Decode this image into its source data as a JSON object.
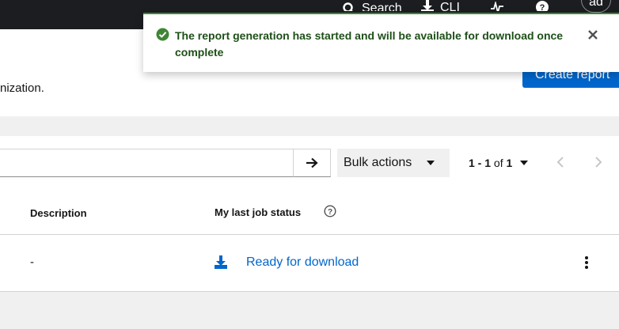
{
  "masthead": {
    "search_label": "Search",
    "cli_label": "CLI",
    "avatar_text": "ad"
  },
  "page": {
    "description_fragment": "nization.",
    "create_button": "Create report"
  },
  "toolbar": {
    "search_value": "",
    "bulk_actions": "Bulk actions",
    "pagination": {
      "range": "1 - 1",
      "of": "of",
      "total": "1"
    }
  },
  "table": {
    "columns": [
      "Description",
      "My last job status"
    ],
    "rows": [
      {
        "description": "-",
        "status": "Ready for download"
      }
    ]
  },
  "toast": {
    "message": "The report generation has started and will be available for download once complete",
    "variant_color": "#3e8635"
  },
  "colors": {
    "primary": "#0066cc",
    "success": "#3e8635",
    "masthead": "#1b1d21"
  }
}
